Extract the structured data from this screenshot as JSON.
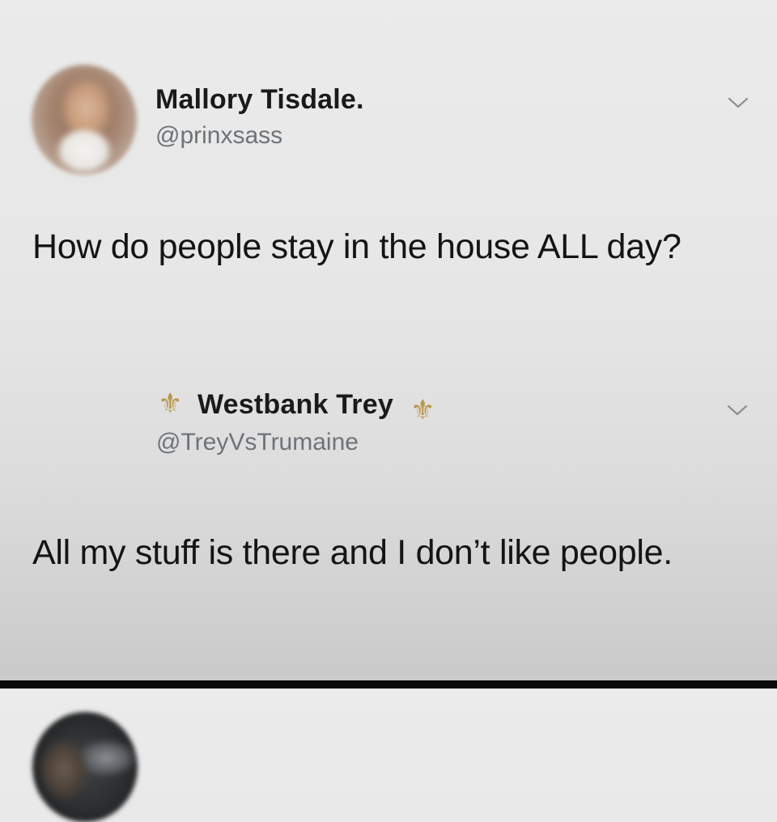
{
  "tweets": [
    {
      "display_name": "Mallory Tisdale.",
      "handle": "@prinxsass",
      "text": "How do people stay in the house ALL day?",
      "avatar_icon": "profile-photo",
      "menu_icon": "chevron-down-icon"
    },
    {
      "display_name": "Westbank Trey",
      "name_decoration": "⚜",
      "handle": "@TreyVsTrumaine",
      "text": "All my stuff is there and I don’t like people.",
      "avatar_icon": "profile-photo",
      "menu_icon": "chevron-down-icon"
    }
  ],
  "colors": {
    "background_top": "#ebebeb",
    "background_bottom": "#c9c9c9",
    "text": "#141414",
    "handle": "#6e7378",
    "fleur_de_lis": "#b8974a"
  }
}
